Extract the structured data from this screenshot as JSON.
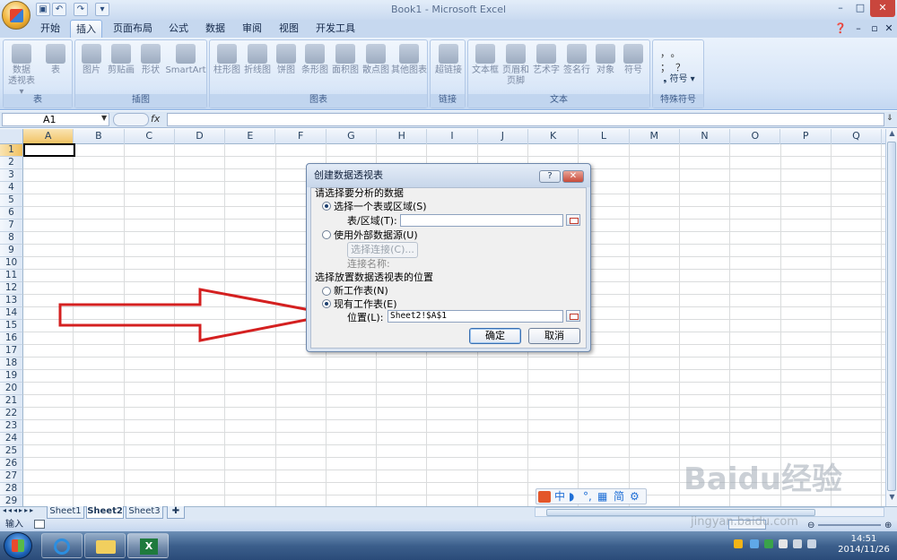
{
  "window": {
    "title": "Book1 - Microsoft Excel"
  },
  "qat": [
    "save-icon",
    "undo-icon",
    "redo-icon",
    "customize-qat-icon"
  ],
  "tabs": [
    {
      "label": "开始"
    },
    {
      "label": "插入"
    },
    {
      "label": "页面布局"
    },
    {
      "label": "公式"
    },
    {
      "label": "数据"
    },
    {
      "label": "审阅"
    },
    {
      "label": "视图"
    },
    {
      "label": "开发工具"
    }
  ],
  "active_tab": "插入",
  "ribbon": {
    "groups": [
      {
        "title": "表",
        "buttons": [
          {
            "label": "数据透视表",
            "l2": "数据",
            "l3": "透视表 ▾"
          },
          {
            "label": "表"
          }
        ]
      },
      {
        "title": "插图",
        "buttons": [
          {
            "label": "图片"
          },
          {
            "label": "剪贴画"
          },
          {
            "label": "形状"
          },
          {
            "label": "SmartArt"
          }
        ]
      },
      {
        "title": "图表",
        "buttons": [
          {
            "label": "柱形图"
          },
          {
            "label": "折线图"
          },
          {
            "label": "饼图"
          },
          {
            "label": "条形图"
          },
          {
            "label": "面积图"
          },
          {
            "label": "散点图"
          },
          {
            "label": "其他图表"
          }
        ]
      },
      {
        "title": "链接",
        "buttons": [
          {
            "label": "超链接"
          }
        ]
      },
      {
        "title": "文本",
        "buttons": [
          {
            "label": "文本框"
          },
          {
            "label": "页眉和页脚",
            "l2": "页眉和",
            "l3": "页脚"
          },
          {
            "label": "艺术字"
          },
          {
            "label": "签名行"
          },
          {
            "label": "对象"
          },
          {
            "label": "符号"
          }
        ]
      },
      {
        "title": "特殊符号",
        "buttons": [
          {
            "label": "符号"
          }
        ]
      }
    ]
  },
  "namebox": "A1",
  "fx": "fx",
  "columns": [
    "A",
    "B",
    "C",
    "D",
    "E",
    "F",
    "G",
    "H",
    "I",
    "J",
    "K",
    "L",
    "M",
    "N",
    "O",
    "P",
    "Q"
  ],
  "rows": [
    "1",
    "2",
    "3",
    "4",
    "5",
    "6",
    "7",
    "8",
    "9",
    "10",
    "11",
    "12",
    "13",
    "14",
    "15",
    "16",
    "17",
    "18",
    "19",
    "20",
    "21",
    "22",
    "23",
    "24",
    "25",
    "26",
    "27",
    "28",
    "29"
  ],
  "sheets": [
    "Sheet1",
    "Sheet2",
    "Sheet3"
  ],
  "active_sheet": "Sheet2",
  "status": {
    "mode": "输入"
  },
  "ime": {
    "cn": "中",
    "jian": "简"
  },
  "watermark": {
    "brand": "Baidu经验",
    "url": "jingyan.baidu.com"
  },
  "clock": {
    "time": "14:51",
    "date": "2014/11/26"
  },
  "dialog": {
    "title": "创建数据透视表",
    "help": "?",
    "close": "✕",
    "section1": "请选择要分析的数据",
    "opt_table": "选择一个表或区域(S)",
    "table_range_label": "表/区域(T):",
    "table_range_value": "",
    "opt_external": "使用外部数据源(U)",
    "choose_conn": "选择连接(C)...",
    "conn_name_label": "连接名称:",
    "section2": "选择放置数据透视表的位置",
    "opt_new_sheet": "新工作表(N)",
    "opt_existing": "现有工作表(E)",
    "location_label": "位置(L):",
    "location_value": "Sheet2!$A$1",
    "ok": "确定",
    "cancel": "取消"
  },
  "colors": {
    "arrow": "#d42020",
    "ribbon_bg": "#d5e4f7",
    "taskbar": "#3c5f8c"
  }
}
